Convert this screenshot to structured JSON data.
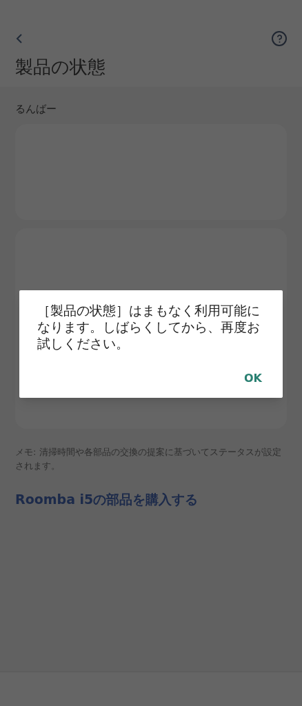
{
  "header": {
    "title": "製品の状態"
  },
  "device_name": "るんばー",
  "note": "メモ: 清掃時間や各部品の交換の提案に基づいてステータスが設定されます。",
  "parts_link": "Roomba i5の部品を購入する",
  "dialog": {
    "message": "［製品の状態］はまもなく利用可能になります。しばらくしてから、再度お試しください。",
    "button": "OK"
  }
}
